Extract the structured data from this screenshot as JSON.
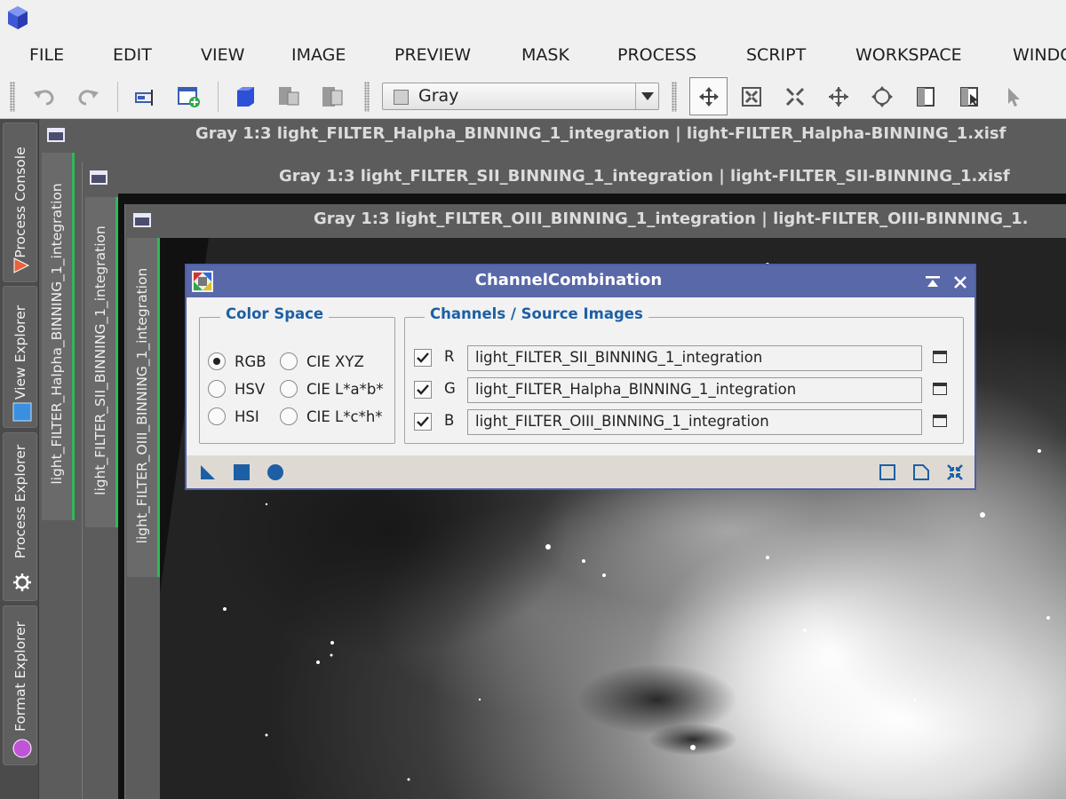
{
  "menu": {
    "items": [
      "FILE",
      "EDIT",
      "VIEW",
      "IMAGE",
      "PREVIEW",
      "MASK",
      "PROCESS",
      "SCRIPT",
      "WORKSPACE",
      "WINDO"
    ]
  },
  "toolbar": {
    "channel_select": "Gray"
  },
  "dock": {
    "tabs": [
      "Process Console",
      "View Explorer",
      "Process Explorer",
      "Format Explorer"
    ]
  },
  "windows": [
    {
      "title": "Gray 1:3 light_FILTER_Halpha_BINNING_1_integration | light-FILTER_Halpha-BINNING_1.xisf",
      "tab": "light_FILTER_Halpha_BINNING_1_integration"
    },
    {
      "title": "Gray 1:3 light_FILTER_SII_BINNING_1_integration | light-FILTER_SII-BINNING_1.xisf",
      "tab": "light_FILTER_SII_BINNING_1_integration"
    },
    {
      "title": "Gray 1:3 light_FILTER_OIII_BINNING_1_integration | light-FILTER_OIII-BINNING_1.",
      "tab": "light_FILTER_OIII_BINNING_1_integration"
    }
  ],
  "dialog": {
    "title": "ChannelCombination",
    "color_space": {
      "title": "Color Space",
      "options": [
        "RGB",
        "CIE XYZ",
        "HSV",
        "CIE L*a*b*",
        "HSI",
        "CIE L*c*h*"
      ],
      "selected": "RGB"
    },
    "channels": {
      "title": "Channels / Source Images",
      "rows": [
        {
          "letter": "R",
          "checked": true,
          "source": "light_FILTER_SII_BINNING_1_integration"
        },
        {
          "letter": "G",
          "checked": true,
          "source": "light_FILTER_Halpha_BINNING_1_integration"
        },
        {
          "letter": "B",
          "checked": true,
          "source": "light_FILTER_OIII_BINNING_1_integration"
        }
      ]
    }
  },
  "colors": {
    "accent_blue": "#1d5fa5",
    "dialog_title_bar": "#5968a8",
    "active_tab_border": "#2fb85a"
  }
}
